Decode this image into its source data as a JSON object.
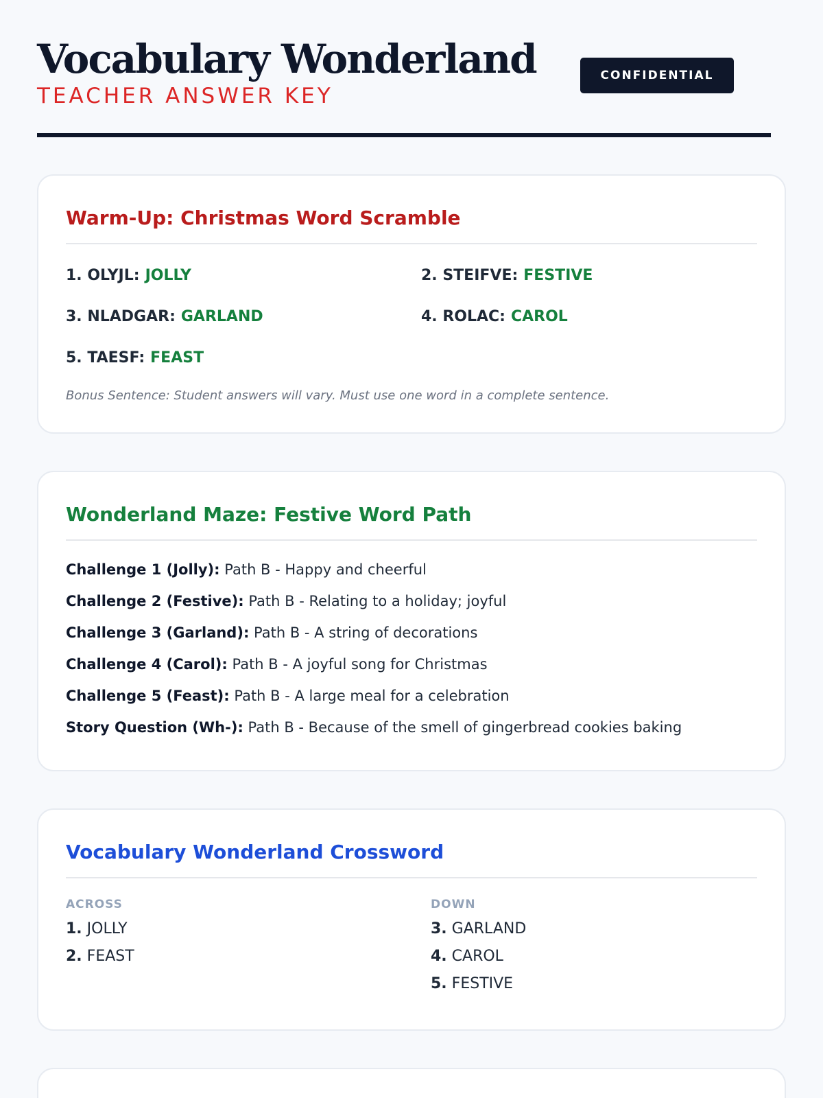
{
  "header": {
    "title": "Vocabulary Wonderland",
    "subtitle": "TEACHER ANSWER KEY",
    "badge": "CONFIDENTIAL"
  },
  "scramble": {
    "title": "Warm-Up: Christmas Word Scramble",
    "items": [
      {
        "prompt": "1. OLYJL:",
        "answer": "JOLLY"
      },
      {
        "prompt": "2. STEIFVE:",
        "answer": "FESTIVE"
      },
      {
        "prompt": "3. NLADGAR:",
        "answer": "GARLAND"
      },
      {
        "prompt": "4. ROLAC:",
        "answer": "CAROL"
      },
      {
        "prompt": "5. TAESF:",
        "answer": "FEAST"
      }
    ],
    "bonus": "Bonus Sentence: Student answers will vary. Must use one word in a complete sentence."
  },
  "maze": {
    "title": "Wonderland Maze: Festive Word Path",
    "items": [
      {
        "label": "Challenge 1 (Jolly):",
        "text": "Path B - Happy and cheerful"
      },
      {
        "label": "Challenge 2 (Festive):",
        "text": "Path B - Relating to a holiday; joyful"
      },
      {
        "label": "Challenge 3 (Garland):",
        "text": "Path B - A string of decorations"
      },
      {
        "label": "Challenge 4 (Carol):",
        "text": "Path B - A joyful song for Christmas"
      },
      {
        "label": "Challenge 5 (Feast):",
        "text": "Path B - A large meal for a celebration"
      },
      {
        "label": "Story Question (Wh-):",
        "text": "Path B - Because of the smell of gingerbread cookies baking"
      }
    ]
  },
  "crossword": {
    "title": "Vocabulary Wonderland Crossword",
    "across_label": "ACROSS",
    "down_label": "DOWN",
    "across": [
      {
        "num": "1.",
        "word": "JOLLY"
      },
      {
        "num": "2.",
        "word": "FEAST"
      }
    ],
    "down": [
      {
        "num": "3.",
        "word": "GARLAND"
      },
      {
        "num": "4.",
        "word": "CAROL"
      },
      {
        "num": "5.",
        "word": "FESTIVE"
      }
    ]
  }
}
